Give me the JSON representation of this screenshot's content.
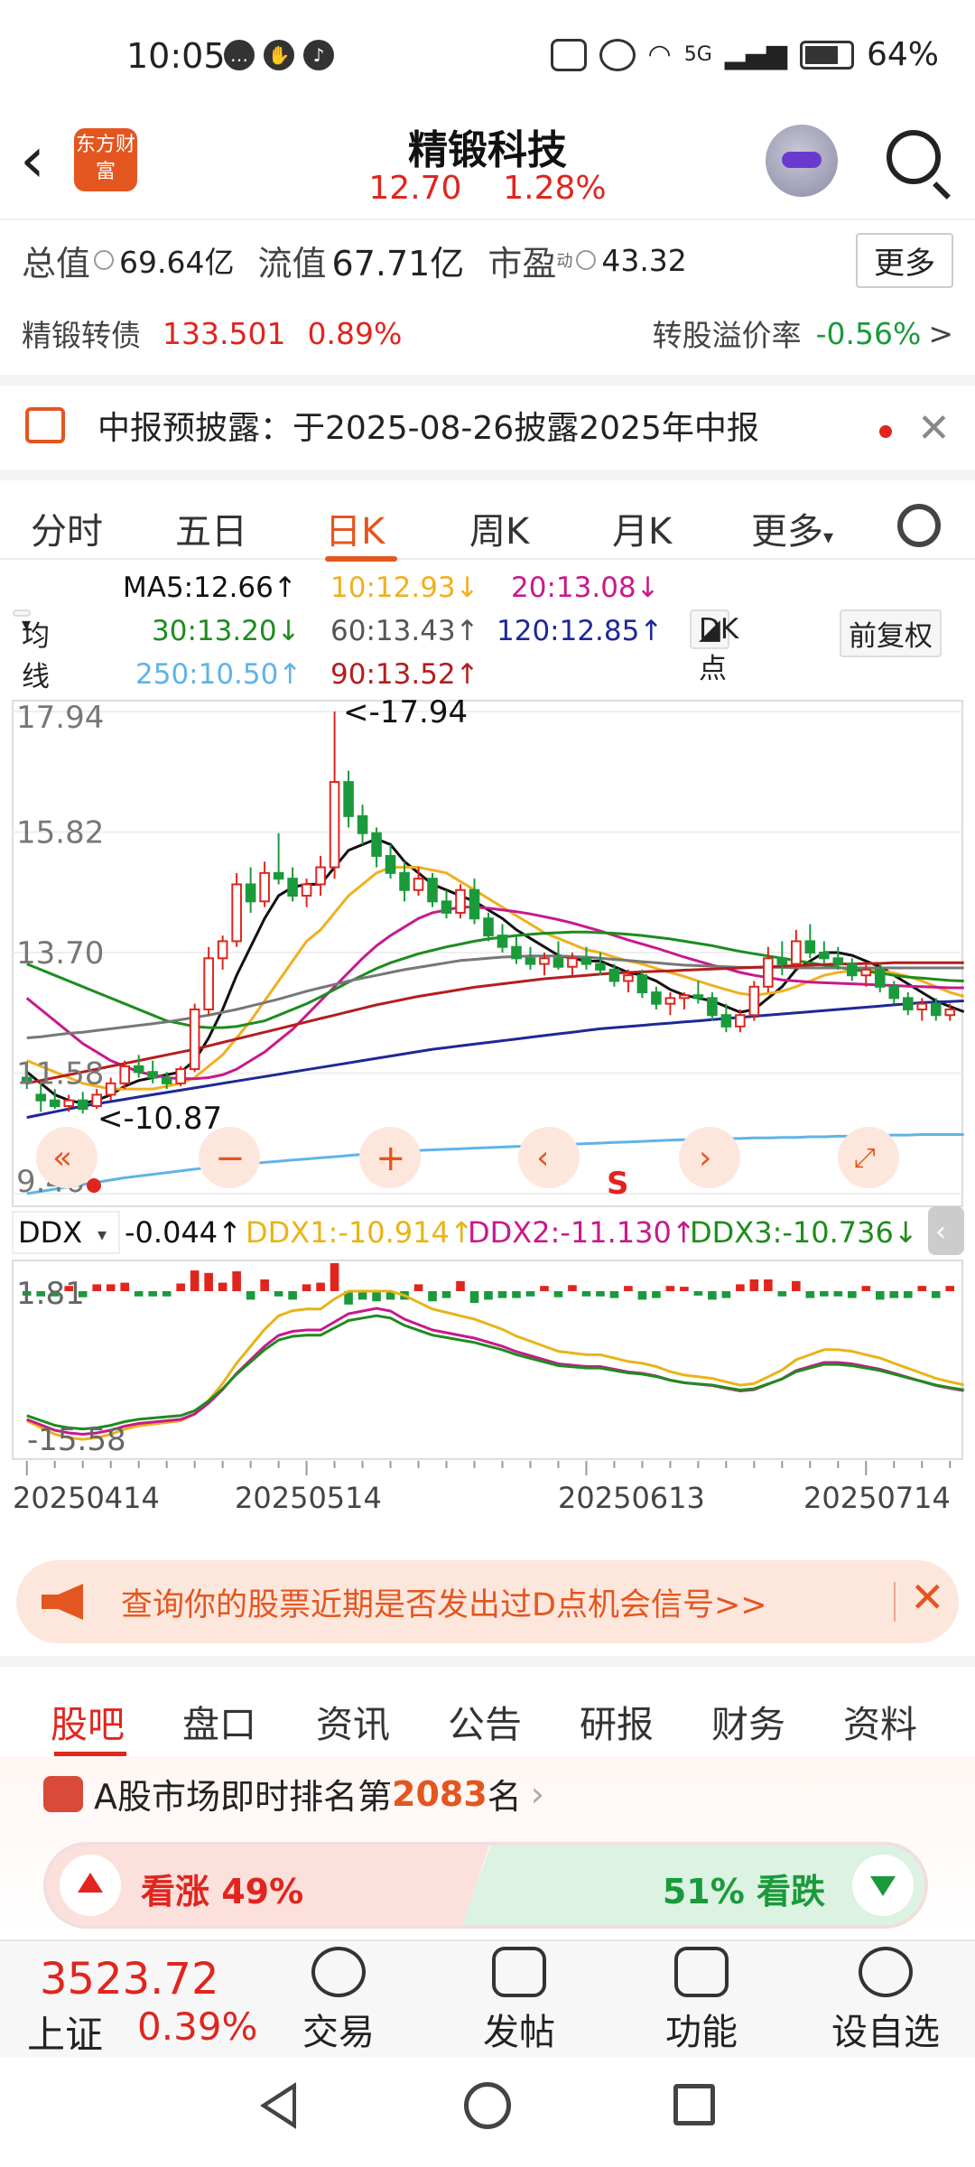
{
  "status_bar": {
    "time": "10:05",
    "signal": "5G",
    "battery": "64%"
  },
  "header": {
    "title": "精锻科技",
    "price": "12.70",
    "change_pct": "1.28%",
    "logo_text": "东方财富"
  },
  "quote": {
    "total_mv_label": "总值",
    "total_mv": "69.64亿",
    "float_mv_label": "流值",
    "float_mv": "67.71亿",
    "pe_label": "市盈",
    "pe_sup": "动",
    "pe": "43.32",
    "more_label": "更多",
    "bond_label": "精锻转债",
    "bond_price": "133.501",
    "bond_pct": "0.89%",
    "premium_label": "转股溢价率",
    "premium": "-0.56%"
  },
  "notice": {
    "text": "中报预披露：于2025-08-26披露2025年中报"
  },
  "period_tabs": [
    "分时",
    "五日",
    "日K",
    "周K",
    "月K",
    "更多"
  ],
  "active_period": "日K",
  "ma_legend": {
    "button": "均线",
    "ma5": "MA5:12.66↑",
    "ma10": "10:12.93↓",
    "ma20": "20:13.08↓",
    "ma30": "30:13.20↓",
    "ma60": "60:13.43↑",
    "ma120": "120:12.85↑",
    "ma250": "250:10.50↑",
    "ma90": "90:13.52↑",
    "dk_button": "DK点",
    "adjust_button": "前复权"
  },
  "colors": {
    "up": "#e0251e",
    "down": "#1a9a3b",
    "accent": "#e4561f"
  },
  "chart_data": {
    "type": "candlestick",
    "y_ticks": [
      "17.94",
      "15.82",
      "13.70",
      "11.58",
      "9.46"
    ],
    "high_label": "<-17.94",
    "low_label": "<-10.87",
    "indicator": {
      "name": "DDX",
      "value": "-0.044↑",
      "ddx1": "DDX1:-10.914↑",
      "ddx2": "DDX2:-11.130↑",
      "ddx3": "DDX3:-10.736↓",
      "y_ticks": [
        "1.81",
        "-15.58"
      ]
    },
    "x_ticks": [
      "20250414",
      "20250514",
      "20250613",
      "20250714"
    ],
    "s_marker": "S",
    "candles": [
      {
        "o": 11.5,
        "h": 11.7,
        "l": 11.3,
        "c": 11.45
      },
      {
        "o": 11.2,
        "h": 11.4,
        "l": 10.9,
        "c": 11.1
      },
      {
        "o": 11.1,
        "h": 11.3,
        "l": 10.95,
        "c": 11.0
      },
      {
        "o": 11.0,
        "h": 11.2,
        "l": 10.9,
        "c": 11.1
      },
      {
        "o": 11.1,
        "h": 11.25,
        "l": 10.87,
        "c": 10.95
      },
      {
        "o": 11.0,
        "h": 11.3,
        "l": 10.95,
        "c": 11.2
      },
      {
        "o": 11.2,
        "h": 11.5,
        "l": 11.1,
        "c": 11.4
      },
      {
        "o": 11.4,
        "h": 11.8,
        "l": 11.3,
        "c": 11.7
      },
      {
        "o": 11.7,
        "h": 11.9,
        "l": 11.5,
        "c": 11.6
      },
      {
        "o": 11.6,
        "h": 11.8,
        "l": 11.4,
        "c": 11.5
      },
      {
        "o": 11.5,
        "h": 11.6,
        "l": 11.3,
        "c": 11.4
      },
      {
        "o": 11.4,
        "h": 11.7,
        "l": 11.35,
        "c": 11.65
      },
      {
        "o": 11.65,
        "h": 12.8,
        "l": 11.6,
        "c": 12.7
      },
      {
        "o": 12.7,
        "h": 13.8,
        "l": 12.6,
        "c": 13.6
      },
      {
        "o": 13.6,
        "h": 14.0,
        "l": 13.4,
        "c": 13.9
      },
      {
        "o": 13.9,
        "h": 15.1,
        "l": 13.8,
        "c": 14.9
      },
      {
        "o": 14.9,
        "h": 15.2,
        "l": 14.4,
        "c": 14.6
      },
      {
        "o": 14.6,
        "h": 15.3,
        "l": 14.5,
        "c": 15.1
      },
      {
        "o": 15.1,
        "h": 15.8,
        "l": 14.9,
        "c": 15.0
      },
      {
        "o": 15.0,
        "h": 15.2,
        "l": 14.6,
        "c": 14.7
      },
      {
        "o": 14.7,
        "h": 15.0,
        "l": 14.5,
        "c": 14.9
      },
      {
        "o": 14.9,
        "h": 15.4,
        "l": 14.7,
        "c": 15.2
      },
      {
        "o": 15.2,
        "h": 17.94,
        "l": 15.0,
        "c": 16.7
      },
      {
        "o": 16.7,
        "h": 16.9,
        "l": 15.9,
        "c": 16.1
      },
      {
        "o": 16.1,
        "h": 16.3,
        "l": 15.6,
        "c": 15.8
      },
      {
        "o": 15.8,
        "h": 15.9,
        "l": 15.2,
        "c": 15.4
      },
      {
        "o": 15.4,
        "h": 15.6,
        "l": 15.0,
        "c": 15.1
      },
      {
        "o": 15.1,
        "h": 15.3,
        "l": 14.6,
        "c": 14.8
      },
      {
        "o": 14.8,
        "h": 15.2,
        "l": 14.7,
        "c": 15.0
      },
      {
        "o": 15.0,
        "h": 15.1,
        "l": 14.5,
        "c": 14.6
      },
      {
        "o": 14.6,
        "h": 14.8,
        "l": 14.3,
        "c": 14.4
      },
      {
        "o": 14.4,
        "h": 14.9,
        "l": 14.3,
        "c": 14.8
      },
      {
        "o": 14.8,
        "h": 15.0,
        "l": 14.2,
        "c": 14.3
      },
      {
        "o": 14.3,
        "h": 14.4,
        "l": 13.9,
        "c": 14.0
      },
      {
        "o": 14.0,
        "h": 14.2,
        "l": 13.7,
        "c": 13.8
      },
      {
        "o": 13.8,
        "h": 14.0,
        "l": 13.5,
        "c": 13.6
      },
      {
        "o": 13.6,
        "h": 13.8,
        "l": 13.4,
        "c": 13.5
      },
      {
        "o": 13.5,
        "h": 13.7,
        "l": 13.3,
        "c": 13.6
      },
      {
        "o": 13.6,
        "h": 13.9,
        "l": 13.4,
        "c": 13.45
      },
      {
        "o": 13.45,
        "h": 13.7,
        "l": 13.3,
        "c": 13.6
      },
      {
        "o": 13.6,
        "h": 13.8,
        "l": 13.4,
        "c": 13.5
      },
      {
        "o": 13.5,
        "h": 13.7,
        "l": 13.3,
        "c": 13.4
      },
      {
        "o": 13.4,
        "h": 13.5,
        "l": 13.1,
        "c": 13.2
      },
      {
        "o": 13.2,
        "h": 13.4,
        "l": 13.0,
        "c": 13.3
      },
      {
        "o": 13.3,
        "h": 13.4,
        "l": 12.9,
        "c": 13.0
      },
      {
        "o": 13.0,
        "h": 13.1,
        "l": 12.7,
        "c": 12.8
      },
      {
        "o": 12.8,
        "h": 13.0,
        "l": 12.6,
        "c": 12.9
      },
      {
        "o": 12.9,
        "h": 13.0,
        "l": 12.7,
        "c": 12.95
      },
      {
        "o": 12.95,
        "h": 13.2,
        "l": 12.8,
        "c": 12.9
      },
      {
        "o": 12.9,
        "h": 13.0,
        "l": 12.5,
        "c": 12.6
      },
      {
        "o": 12.6,
        "h": 12.8,
        "l": 12.3,
        "c": 12.4
      },
      {
        "o": 12.4,
        "h": 12.7,
        "l": 12.3,
        "c": 12.6
      },
      {
        "o": 12.6,
        "h": 13.2,
        "l": 12.5,
        "c": 13.1
      },
      {
        "o": 13.1,
        "h": 13.8,
        "l": 13.0,
        "c": 13.6
      },
      {
        "o": 13.6,
        "h": 13.9,
        "l": 13.3,
        "c": 13.5
      },
      {
        "o": 13.5,
        "h": 14.1,
        "l": 13.4,
        "c": 13.9
      },
      {
        "o": 13.9,
        "h": 14.2,
        "l": 13.6,
        "c": 13.7
      },
      {
        "o": 13.7,
        "h": 13.9,
        "l": 13.5,
        "c": 13.6
      },
      {
        "o": 13.6,
        "h": 13.8,
        "l": 13.4,
        "c": 13.5
      },
      {
        "o": 13.5,
        "h": 13.6,
        "l": 13.2,
        "c": 13.3
      },
      {
        "o": 13.3,
        "h": 13.5,
        "l": 13.1,
        "c": 13.4
      },
      {
        "o": 13.4,
        "h": 13.5,
        "l": 13.0,
        "c": 13.1
      },
      {
        "o": 13.1,
        "h": 13.2,
        "l": 12.8,
        "c": 12.9
      },
      {
        "o": 12.9,
        "h": 13.0,
        "l": 12.6,
        "c": 12.7
      },
      {
        "o": 12.7,
        "h": 12.9,
        "l": 12.5,
        "c": 12.8
      },
      {
        "o": 12.8,
        "h": 12.9,
        "l": 12.5,
        "c": 12.6
      },
      {
        "o": 12.6,
        "h": 12.8,
        "l": 12.5,
        "c": 12.7
      }
    ],
    "ma_series": [
      {
        "name": "MA5",
        "color": "#111111",
        "values": [
          11.6,
          11.4,
          11.2,
          11.1,
          11.05,
          11.1,
          11.2,
          11.35,
          11.45,
          11.5,
          11.55,
          11.6,
          11.8,
          12.2,
          12.7,
          13.3,
          13.8,
          14.3,
          14.7,
          14.85,
          14.9,
          14.9,
          15.2,
          15.5,
          15.6,
          15.7,
          15.6,
          15.3,
          15.1,
          14.9,
          14.8,
          14.7,
          14.6,
          14.45,
          14.3,
          14.1,
          13.95,
          13.8,
          13.65,
          13.6,
          13.55,
          13.55,
          13.45,
          13.35,
          13.3,
          13.2,
          13.05,
          12.95,
          12.9,
          12.85,
          12.75,
          12.65,
          12.7,
          12.9,
          13.1,
          13.4,
          13.55,
          13.7,
          13.7,
          13.65,
          13.55,
          13.45,
          13.3,
          13.15,
          13.0,
          12.85,
          12.75,
          12.66
        ]
      },
      {
        "name": "MA10",
        "color": "#f0b020",
        "values": [
          11.8,
          11.7,
          11.6,
          11.5,
          11.4,
          11.35,
          11.3,
          11.3,
          11.3,
          11.3,
          11.35,
          11.4,
          11.5,
          11.7,
          11.9,
          12.2,
          12.5,
          12.85,
          13.2,
          13.55,
          13.9,
          14.1,
          14.4,
          14.7,
          14.9,
          15.1,
          15.2,
          15.2,
          15.2,
          15.15,
          15.1,
          14.95,
          14.8,
          14.65,
          14.5,
          14.35,
          14.2,
          14.05,
          13.95,
          13.85,
          13.75,
          13.7,
          13.62,
          13.55,
          13.5,
          13.42,
          13.35,
          13.28,
          13.2,
          13.12,
          13.05,
          12.98,
          12.95,
          12.98,
          13.02,
          13.1,
          13.2,
          13.3,
          13.35,
          13.38,
          13.4,
          13.38,
          13.34,
          13.28,
          13.2,
          13.1,
          13.0,
          12.93
        ]
      },
      {
        "name": "MA20",
        "color": "#c8198c",
        "values": [
          12.9,
          12.7,
          12.5,
          12.3,
          12.1,
          11.95,
          11.8,
          11.7,
          11.6,
          11.55,
          11.5,
          11.48,
          11.48,
          11.5,
          11.55,
          11.65,
          11.8,
          11.95,
          12.15,
          12.35,
          12.6,
          12.85,
          13.1,
          13.35,
          13.6,
          13.82,
          14.0,
          14.15,
          14.3,
          14.4,
          14.45,
          14.5,
          14.5,
          14.48,
          14.45,
          14.42,
          14.38,
          14.33,
          14.28,
          14.22,
          14.15,
          14.08,
          14.0,
          13.92,
          13.85,
          13.78,
          13.7,
          13.62,
          13.55,
          13.48,
          13.42,
          13.35,
          13.3,
          13.26,
          13.22,
          13.2,
          13.18,
          13.17,
          13.16,
          13.15,
          13.14,
          13.13,
          13.12,
          13.11,
          13.1,
          13.09,
          13.08,
          13.08
        ]
      },
      {
        "name": "MA30",
        "color": "#1e8c1e",
        "values": [
          13.5,
          13.4,
          13.3,
          13.2,
          13.1,
          13.0,
          12.9,
          12.8,
          12.7,
          12.6,
          12.5,
          12.45,
          12.4,
          12.38,
          12.38,
          12.4,
          12.45,
          12.5,
          12.6,
          12.7,
          12.8,
          12.92,
          13.05,
          13.18,
          13.3,
          13.42,
          13.52,
          13.6,
          13.68,
          13.74,
          13.8,
          13.85,
          13.9,
          13.94,
          13.97,
          14.0,
          14.02,
          14.04,
          14.05,
          14.06,
          14.06,
          14.05,
          14.04,
          14.02,
          14.0,
          13.97,
          13.94,
          13.9,
          13.86,
          13.82,
          13.77,
          13.72,
          13.68,
          13.64,
          13.6,
          13.56,
          13.52,
          13.48,
          13.44,
          13.4,
          13.37,
          13.34,
          13.3,
          13.27,
          13.25,
          13.23,
          13.21,
          13.2
        ]
      },
      {
        "name": "MA60",
        "color": "#777777",
        "values": [
          12.2,
          12.22,
          12.25,
          12.28,
          12.3,
          12.33,
          12.36,
          12.39,
          12.42,
          12.45,
          12.48,
          12.52,
          12.56,
          12.6,
          12.65,
          12.7,
          12.76,
          12.82,
          12.88,
          12.95,
          13.02,
          13.08,
          13.14,
          13.2,
          13.25,
          13.3,
          13.35,
          13.4,
          13.44,
          13.48,
          13.52,
          13.56,
          13.58,
          13.6,
          13.62,
          13.63,
          13.64,
          13.64,
          13.64,
          13.63,
          13.62,
          13.6,
          13.58,
          13.56,
          13.54,
          13.52,
          13.5,
          13.48,
          13.47,
          13.46,
          13.45,
          13.44,
          13.44,
          13.44,
          13.44,
          13.43,
          13.43,
          13.43,
          13.43,
          13.43,
          13.43,
          13.43,
          13.43,
          13.43,
          13.43,
          13.43,
          13.43,
          13.43
        ]
      },
      {
        "name": "MA90",
        "color": "#b41e1e",
        "values": [
          11.4,
          11.45,
          11.5,
          11.55,
          11.6,
          11.65,
          11.7,
          11.75,
          11.8,
          11.85,
          11.9,
          11.95,
          12.0,
          12.06,
          12.12,
          12.18,
          12.24,
          12.3,
          12.36,
          12.42,
          12.48,
          12.54,
          12.6,
          12.66,
          12.72,
          12.78,
          12.83,
          12.88,
          12.93,
          12.97,
          13.01,
          13.05,
          13.09,
          13.12,
          13.15,
          13.18,
          13.21,
          13.24,
          13.26,
          13.28,
          13.3,
          13.32,
          13.34,
          13.35,
          13.36,
          13.37,
          13.38,
          13.39,
          13.4,
          13.41,
          13.42,
          13.43,
          13.44,
          13.45,
          13.46,
          13.47,
          13.48,
          13.49,
          13.5,
          13.5,
          13.51,
          13.51,
          13.52,
          13.52,
          13.52,
          13.52,
          13.52,
          13.52
        ]
      },
      {
        "name": "MA120",
        "color": "#1e2896",
        "values": [
          10.8,
          10.85,
          10.9,
          10.95,
          11.0,
          11.04,
          11.08,
          11.12,
          11.16,
          11.2,
          11.24,
          11.28,
          11.32,
          11.36,
          11.4,
          11.44,
          11.48,
          11.52,
          11.56,
          11.6,
          11.64,
          11.68,
          11.72,
          11.76,
          11.8,
          11.84,
          11.88,
          11.92,
          11.96,
          12.0,
          12.03,
          12.06,
          12.09,
          12.12,
          12.15,
          12.18,
          12.21,
          12.24,
          12.27,
          12.3,
          12.33,
          12.36,
          12.38,
          12.4,
          12.42,
          12.44,
          12.46,
          12.48,
          12.5,
          12.52,
          12.54,
          12.56,
          12.58,
          12.6,
          12.62,
          12.64,
          12.66,
          12.68,
          12.7,
          12.72,
          12.74,
          12.76,
          12.78,
          12.8,
          12.82,
          12.83,
          12.84,
          12.85
        ]
      },
      {
        "name": "MA250",
        "color": "#5fb4e6",
        "values": [
          9.46,
          9.5,
          9.54,
          9.58,
          9.62,
          9.66,
          9.7,
          9.74,
          9.77,
          9.8,
          9.83,
          9.86,
          9.89,
          9.92,
          9.95,
          9.97,
          9.99,
          10.01,
          10.03,
          10.05,
          10.07,
          10.09,
          10.11,
          10.13,
          10.15,
          10.17,
          10.19,
          10.21,
          10.22,
          10.23,
          10.24,
          10.25,
          10.26,
          10.27,
          10.28,
          10.29,
          10.3,
          10.31,
          10.32,
          10.33,
          10.34,
          10.35,
          10.36,
          10.37,
          10.38,
          10.39,
          10.4,
          10.41,
          10.42,
          10.42,
          10.43,
          10.43,
          10.44,
          10.44,
          10.45,
          10.45,
          10.46,
          10.46,
          10.47,
          10.47,
          10.48,
          10.48,
          10.49,
          10.49,
          10.5,
          10.5,
          10.5,
          10.5
        ]
      }
    ]
  },
  "promo": {
    "text": "查询你的股票近期是否发出过D点机会信号>>"
  },
  "section_tabs": [
    "股吧",
    "盘口",
    "资讯",
    "公告",
    "研报",
    "财务",
    "资料"
  ],
  "ranking": {
    "prefix": "A股市场即时排名第",
    "rank": "2083",
    "suffix": "名"
  },
  "vote": {
    "up": "看涨 49%",
    "down": "51% 看跌",
    "up_share": 0.49
  },
  "bottom": {
    "index_value": "3523.72",
    "index_name": "上证",
    "index_pct": "0.39%",
    "nav": [
      "交易",
      "发帖",
      "功能",
      "设自选"
    ]
  }
}
